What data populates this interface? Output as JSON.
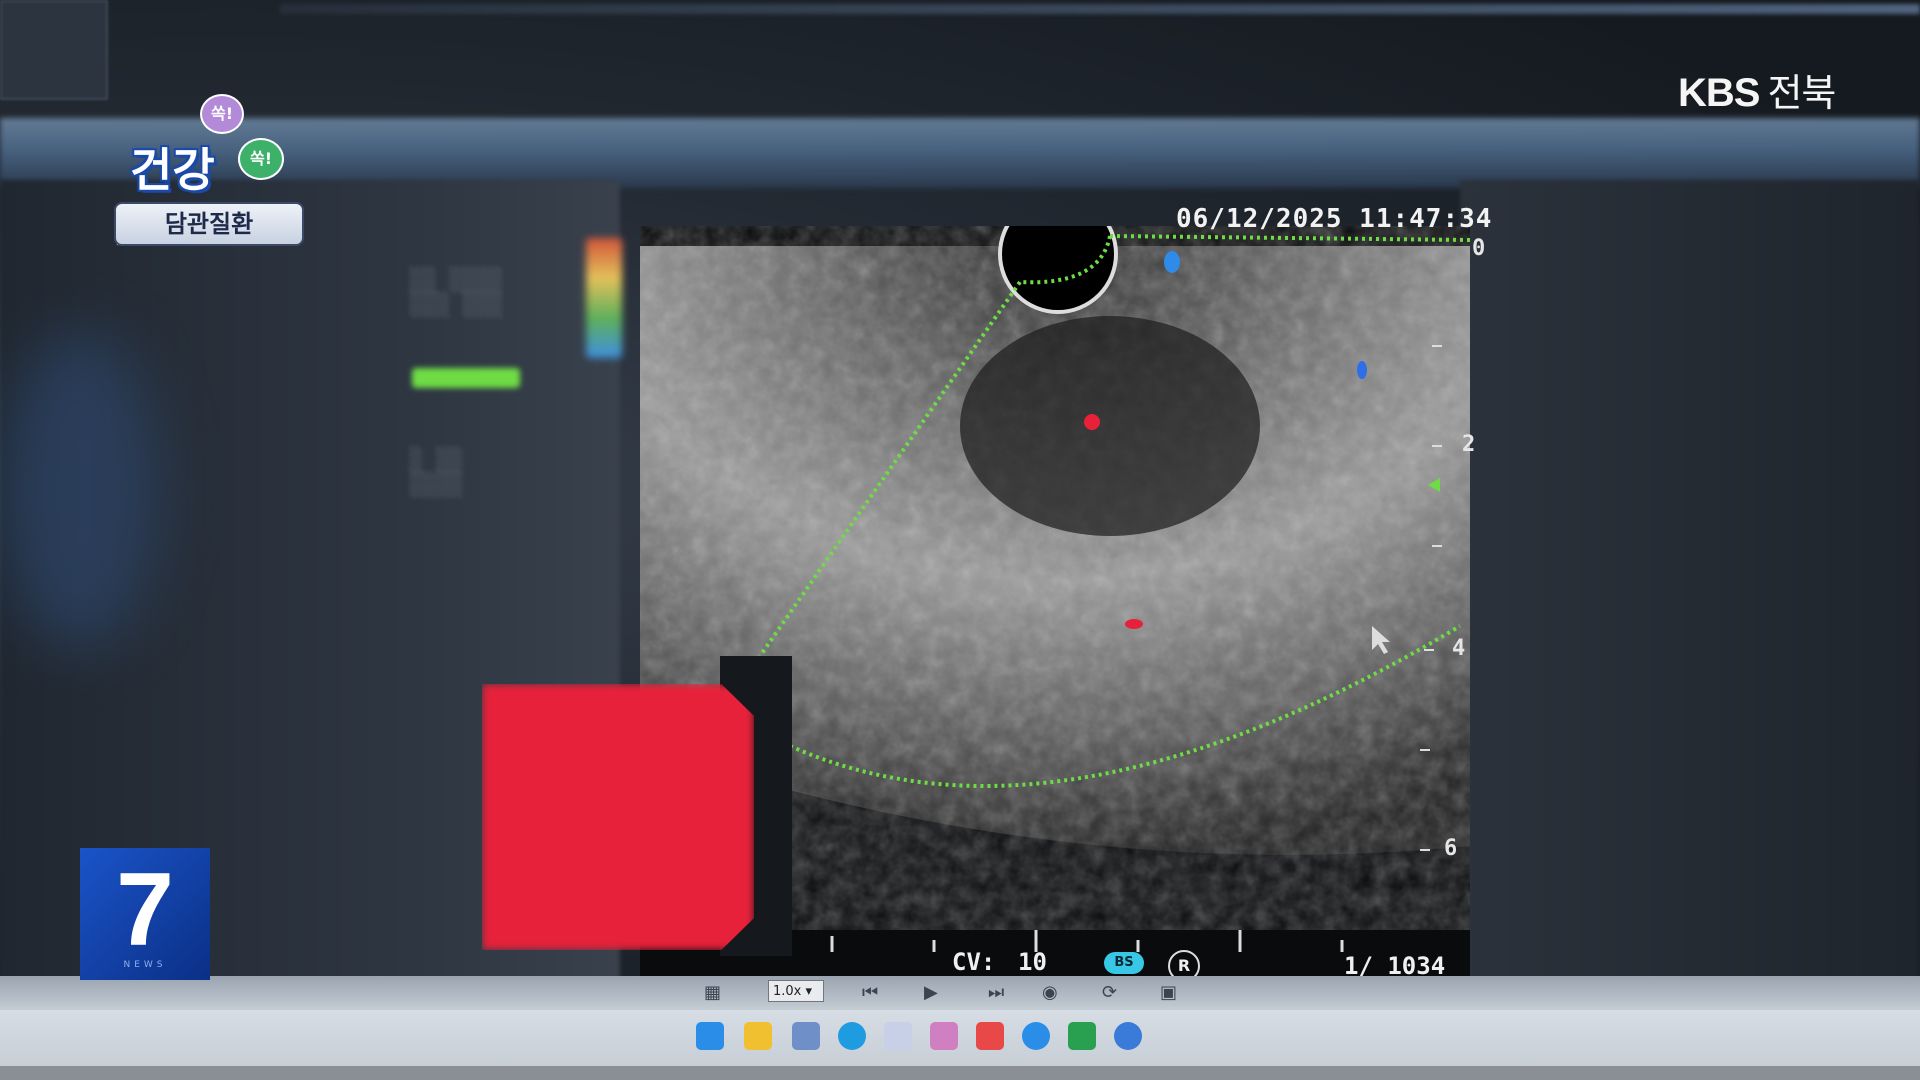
{
  "broadcaster": {
    "logo": "KBS",
    "region": "전북",
    "news_number": "7",
    "news_sub": "NEWS"
  },
  "segment": {
    "title": "건강",
    "badge_top": "쏙!",
    "badge_bottom": "쏙!",
    "topic": "담관질환"
  },
  "ultrasound": {
    "timestamp": "06/12/2025 11:47:34",
    "depth_marks": [
      "0",
      "2",
      "4",
      "6"
    ],
    "cv_label": "CV:",
    "cv_value": "10",
    "bs_label": "BS",
    "r_label": "R",
    "frame_counter": "1/ 1034"
  },
  "player": {
    "zoom": "1.0x"
  },
  "colors": {
    "accent_red": "#e8213a",
    "sector_green": "#6fdc45",
    "news_blue": "#1a54c8"
  }
}
